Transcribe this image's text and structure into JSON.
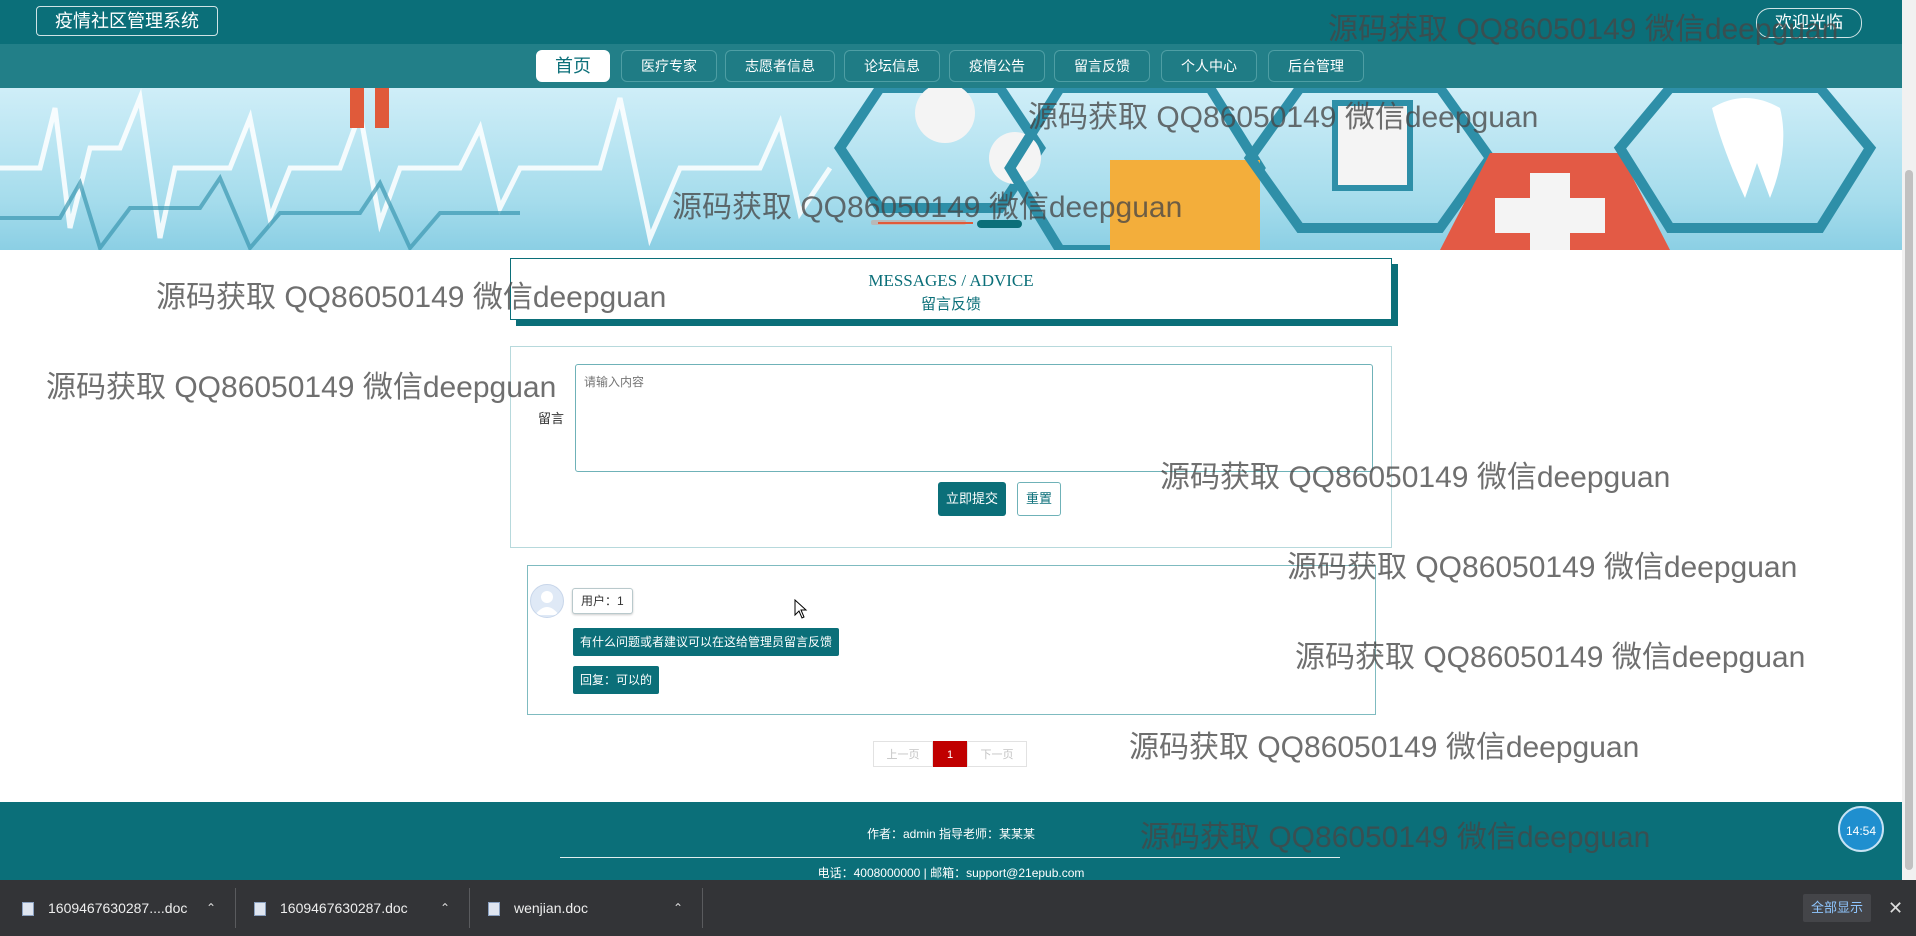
{
  "header": {
    "system_title": "疫情社区管理系统",
    "welcome": "欢迎光临"
  },
  "nav": {
    "items": [
      "首页",
      "医疗专家",
      "志愿者信息",
      "论坛信息",
      "疫情公告",
      "留言反馈",
      "个人中心",
      "后台管理"
    ],
    "active_index": 0
  },
  "section": {
    "title_en": "MESSAGES / ADVICE",
    "title_cn": "留言反馈"
  },
  "form": {
    "label": "留言",
    "placeholder": "请输入内容",
    "submit_label": "立即提交",
    "reset_label": "重置"
  },
  "comment": {
    "user": "用户：1",
    "message": "有什么问题或者建议可以在这给管理员留言反馈",
    "reply": "回复：可以的"
  },
  "pagination": {
    "prev": "上一页",
    "current": "1",
    "next": "下一页"
  },
  "footer": {
    "author": "作者：admin 指导老师：某某某",
    "contact": "电话：4008000000 | 邮箱：support@21epub.com"
  },
  "clock": "14:54",
  "downloads": {
    "items": [
      "1609467630287....doc",
      "1609467630287.doc",
      "wenjian.doc"
    ],
    "show_all": "全部显示"
  },
  "watermark": "源码获取 QQ86050149 微信deepguan",
  "colors": {
    "primary": "#0b6f79",
    "nav": "#227f88",
    "page_current": "#c00000"
  }
}
